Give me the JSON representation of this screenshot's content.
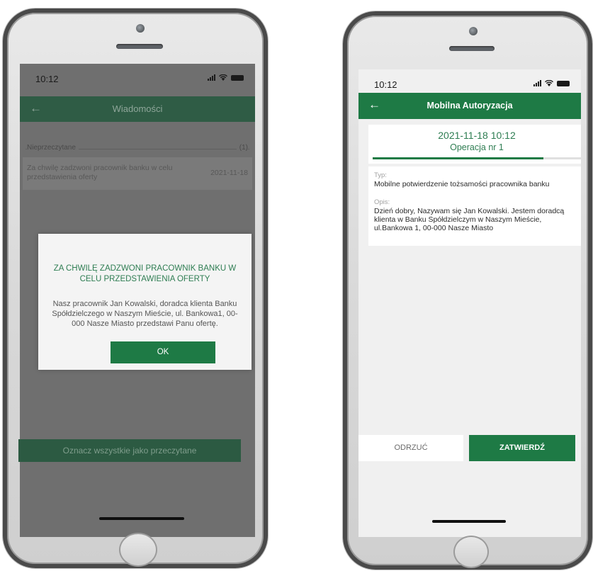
{
  "colors": {
    "brand_green": "#1e7a45",
    "text_green": "#2e7d52",
    "overlay_gray": "#6f6f6f"
  },
  "left_phone": {
    "status_time": "10:12",
    "header_title": "Wiadomości",
    "section_label": "Nieprzeczytane",
    "section_count": "(1)",
    "message": {
      "text": "Za chwilę zadzwoni pracownik banku w celu przedstawienia oferty",
      "date": "2021-11-18"
    },
    "dialog": {
      "title": "ZA CHWILĘ ZADZWONI PRACOWNIK BANKU W CELU PRZEDSTAWIENIA OFERTY",
      "body": "Nasz pracownik Jan Kowalski, doradca klienta Banku Spółdzielczego w Naszym Mieście, ul. Bankowa1, 00-000 Nasze Miasto przedstawi Panu ofertę.",
      "ok_label": "OK"
    },
    "mark_all_label": "Oznacz wszystkie jako przeczytane"
  },
  "right_phone": {
    "status_time": "10:12",
    "header_title": "Mobilna Autoryzacja",
    "operation": {
      "datetime": "2021-11-18 10:12",
      "number_label": "Operacja nr 1",
      "progress_fraction": 0.82
    },
    "details": {
      "type_label": "Typ:",
      "type_value": "Mobilne potwierdzenie tożsamości pracownika banku",
      "description_label": "Opis:",
      "description_value": "Dzień dobry, Nazywam się Jan Kowalski. Jestem doradcą klienta w Banku Spółdzielczym w Naszym Mieście, ul.Bankowa 1, 00-000 Nasze Miasto"
    },
    "reject_label": "ODRZUĆ",
    "confirm_label": "ZATWIERDŹ"
  }
}
